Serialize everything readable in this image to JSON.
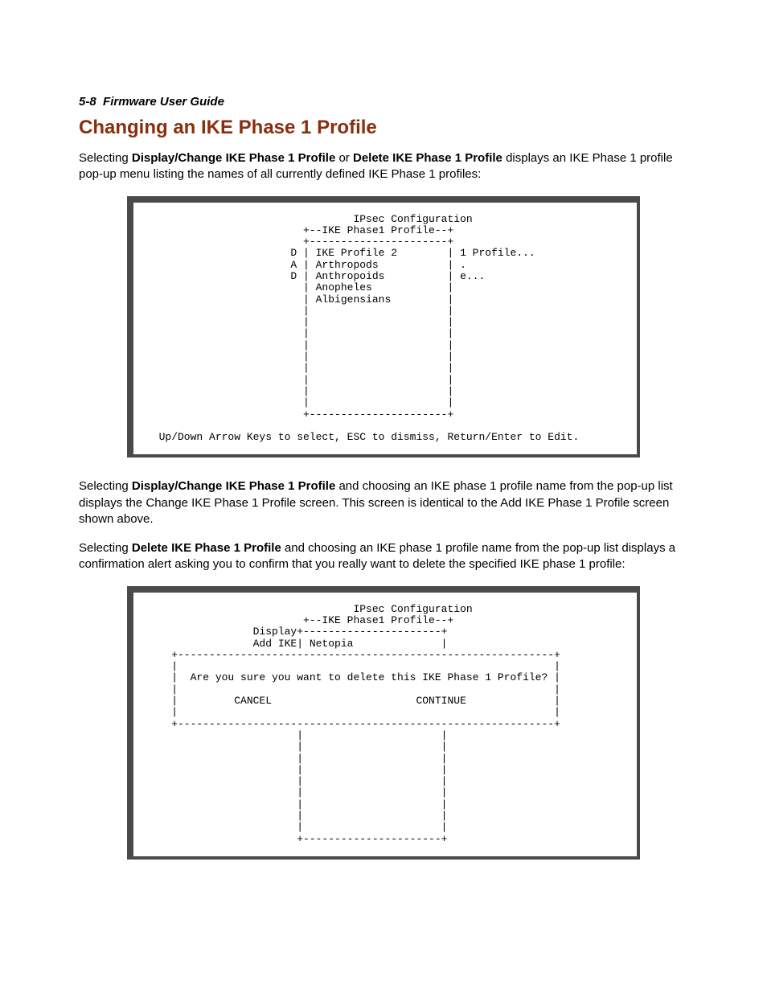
{
  "header": {
    "page_ref": "5-8",
    "doc_title": "Firmware User Guide"
  },
  "title": "Changing an IKE Phase 1 Profile",
  "para1": {
    "lead": "Selecting ",
    "b1": "Display/Change IKE Phase 1 Profile",
    "mid": " or ",
    "b2": "Delete IKE Phase 1 Profile",
    "tail": " displays an IKE Phase 1 profile pop-up menu listing the names of all currently defined IKE Phase 1 profiles:"
  },
  "terminal1": "                                 IPsec Configuration\n                         +--IKE Phase1 Profile--+\n                         +----------------------+\n                       D | IKE Profile 2        | 1 Profile...\n                       A | Arthropods           | .\n                       D | Anthropoids          | e...\n                         | Anopheles            |\n                         | Albigensians         |\n                         |                      |\n                         |                      |\n                         |                      |\n                         |                      |\n                         |                      |\n                         |                      |\n                         |                      |\n                         |                      |\n                         |                      |\n                         +----------------------+\n\n  Up/Down Arrow Keys to select, ESC to dismiss, Return/Enter to Edit.",
  "para2": {
    "lead": "Selecting ",
    "b1": "Display/Change IKE Phase 1 Profile",
    "tail": " and choosing an IKE phase 1 profile name from the pop-up list displays the Change IKE Phase 1 Profile screen. This screen is identical to the Add IKE Phase 1 Profile screen shown above."
  },
  "para3": {
    "lead": "Selecting ",
    "b1": "Delete IKE Phase 1 Profile",
    "tail": " and choosing an IKE phase 1 profile name from the pop-up list displays a confirmation alert asking you to confirm that you really want to delete the specified IKE phase 1 profile:"
  },
  "terminal2": "                                 IPsec Configuration\n                         +--IKE Phase1 Profile--+\n                 Display+----------------------+\n                 Add IKE| Netopia              |\n    +------------------------------------------------------------+\n    |                                                            |\n    |  Are you sure you want to delete this IKE Phase 1 Profile? |\n    |                                                            |\n    |         CANCEL                       CONTINUE              |\n    |                                                            |\n    +------------------------------------------------------------+\n                        |                      |\n                        |                      |\n                        |                      |\n                        |                      |\n                        |                      |\n                        |                      |\n                        |                      |\n                        |                      |\n                        |                      |\n                        +----------------------+"
}
